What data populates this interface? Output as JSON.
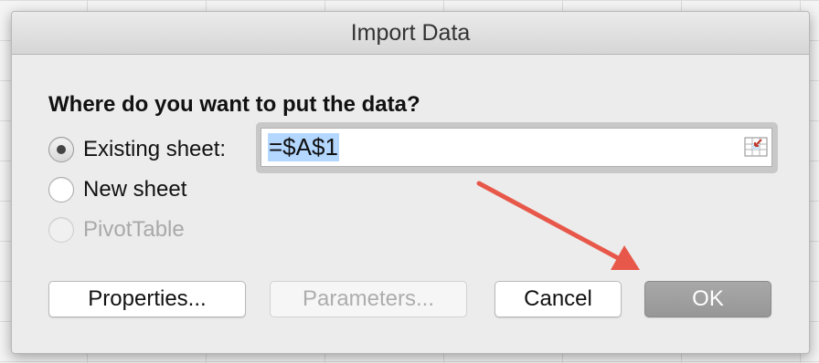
{
  "dialog": {
    "title": "Import Data",
    "question": "Where do you want to put the data?",
    "options": {
      "existing_sheet": "Existing sheet:",
      "new_sheet": "New sheet",
      "pivot_table": "PivotTable"
    },
    "selected_option": "existing_sheet",
    "reference_value": "=$A$1",
    "buttons": {
      "properties": "Properties...",
      "parameters": "Parameters...",
      "cancel": "Cancel",
      "ok": "OK"
    }
  },
  "annotation": {
    "arrow_color": "#e8584a",
    "points_to": "ok-button"
  },
  "colors": {
    "selection": "#b3d7ff",
    "default_button": "#a0a0a0"
  }
}
